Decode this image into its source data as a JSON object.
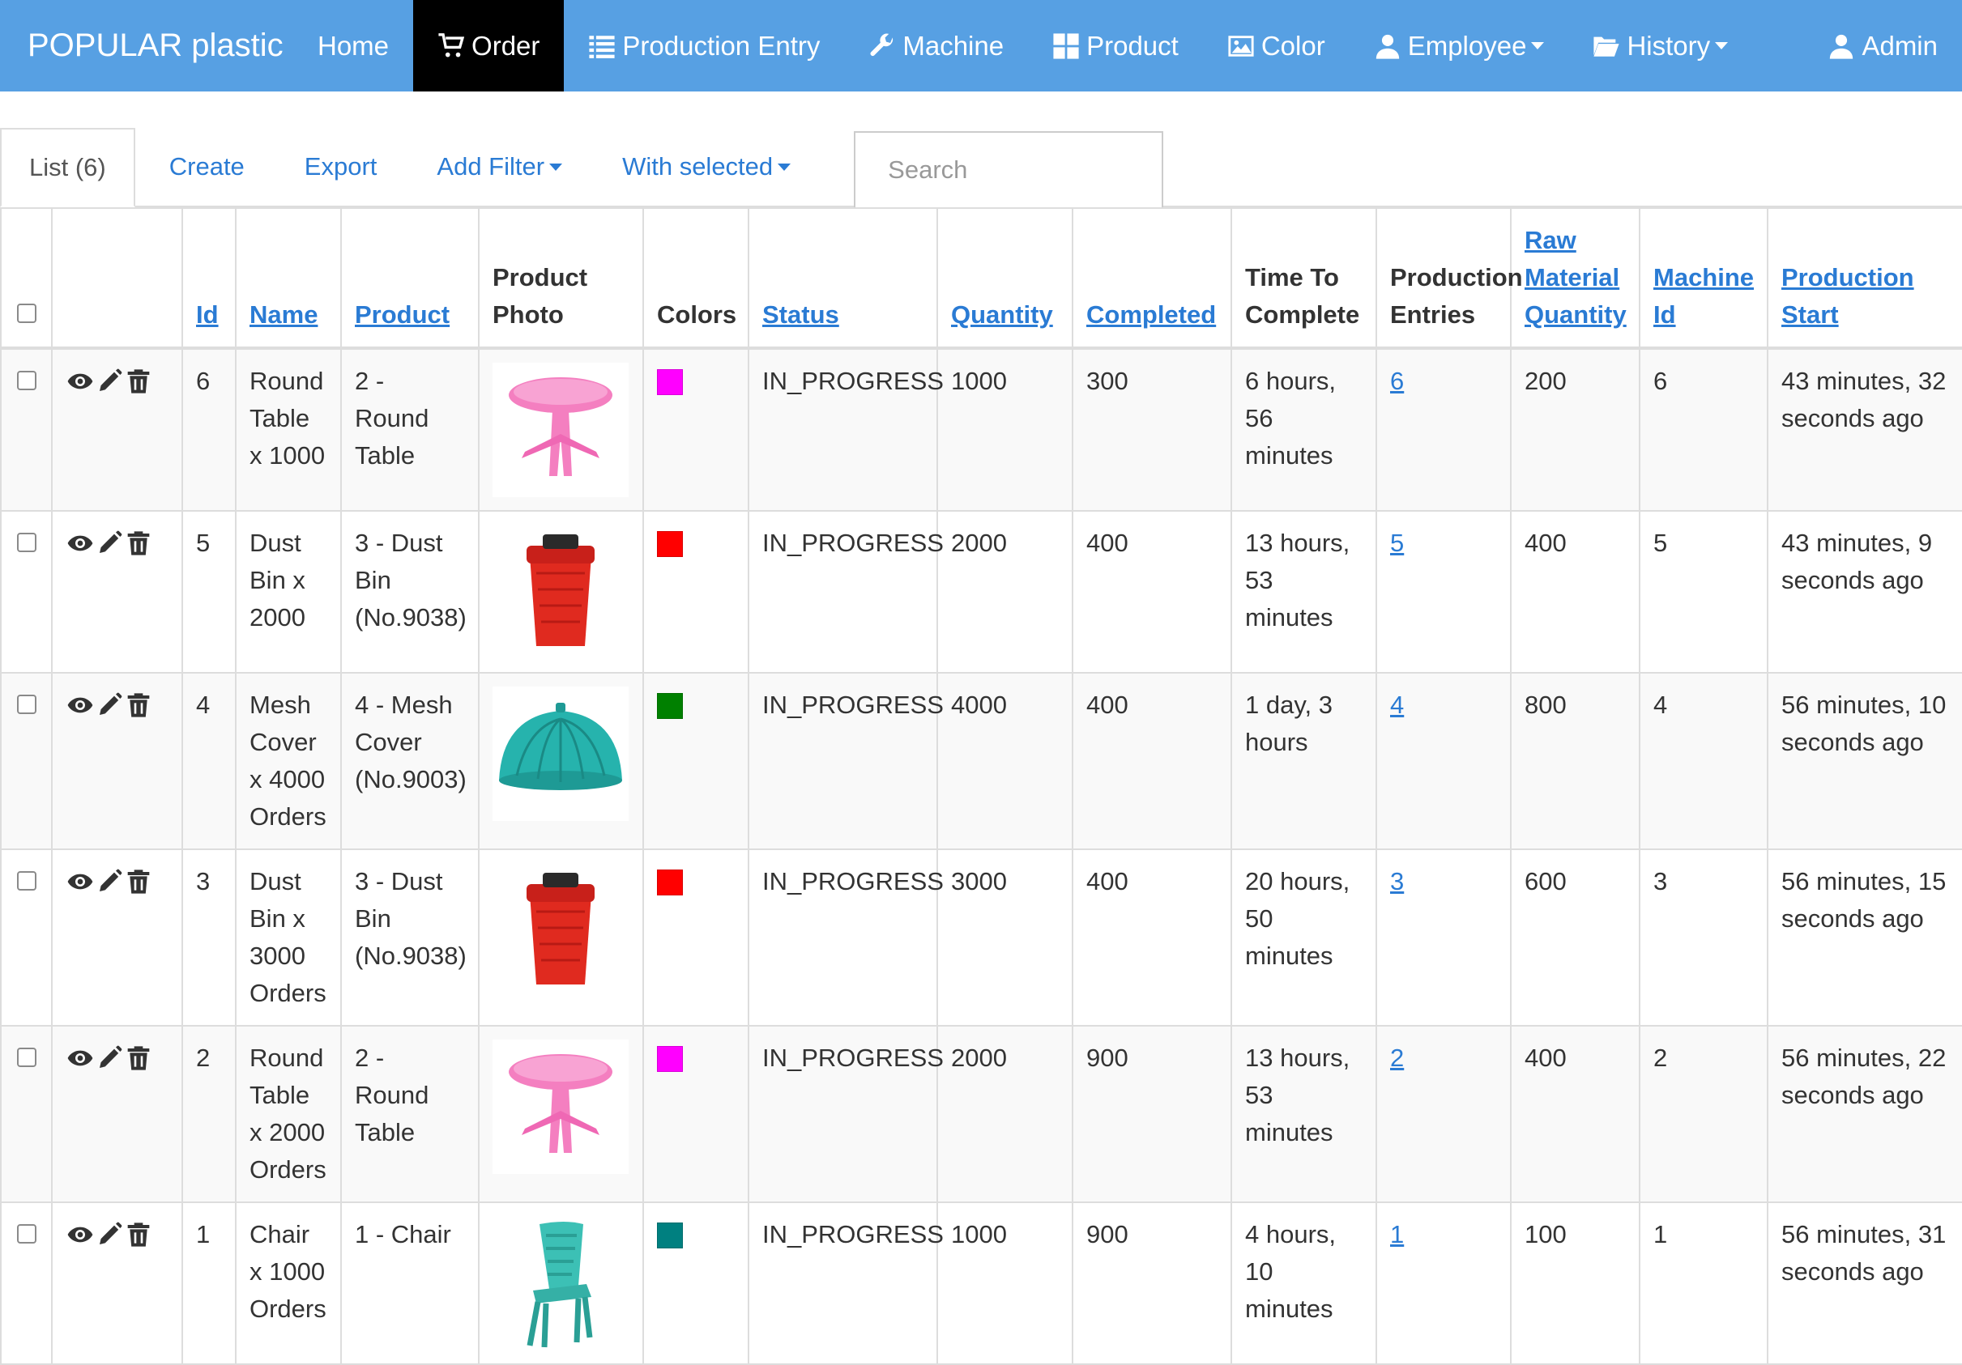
{
  "navbar": {
    "brand": "POPULAR plastic",
    "items": [
      {
        "label": "Home",
        "icon": "none",
        "active": false
      },
      {
        "label": "Order",
        "icon": "cart-icon",
        "active": true
      },
      {
        "label": "Production Entry",
        "icon": "list-icon",
        "active": false
      },
      {
        "label": "Machine",
        "icon": "wrench-icon",
        "active": false
      },
      {
        "label": "Product",
        "icon": "grid-icon",
        "active": false
      },
      {
        "label": "Color",
        "icon": "picture-icon",
        "active": false
      },
      {
        "label": "Employee",
        "icon": "user-icon",
        "active": false,
        "dropdown": true
      },
      {
        "label": "History",
        "icon": "folder-open-icon",
        "active": false,
        "dropdown": true
      }
    ],
    "user": {
      "label": "Admin",
      "icon": "user-icon"
    },
    "accent_color": "#57a0e3"
  },
  "tabs": {
    "list": "List (6)",
    "create": "Create",
    "export": "Export",
    "add_filter": "Add Filter",
    "with_selected": "With selected",
    "search_placeholder": "Search"
  },
  "table": {
    "headers": {
      "id": "Id",
      "name": "Name",
      "product": "Product",
      "product_photo": "Product Photo",
      "colors": "Colors",
      "status": "Status",
      "quantity": "Quantity",
      "completed": "Completed",
      "time_to_complete": "Time To Complete",
      "production_entries": "Production Entries",
      "raw_material_quantity": "Raw Material Quantity",
      "machine_id": "Machine Id",
      "production_start": "Production Start"
    },
    "rows": [
      {
        "id": "6",
        "name": "Round Table x 1000",
        "product": "2 - Round Table",
        "photo": "round-table-pink",
        "color": "#ff00ff",
        "status": "IN_PROGRESS",
        "quantity": "1000",
        "completed": "300",
        "time_to_complete": "6 hours, 56 minutes",
        "production_entries": "6",
        "raw_material_quantity": "200",
        "machine_id": "6",
        "production_start": "43 minutes, 32 seconds ago"
      },
      {
        "id": "5",
        "name": "Dust Bin x 2000",
        "product": "3 - Dust Bin (No.9038)",
        "photo": "dust-bin-red",
        "color": "#ff0000",
        "status": "IN_PROGRESS",
        "quantity": "2000",
        "completed": "400",
        "time_to_complete": "13 hours, 53 minutes",
        "production_entries": "5",
        "raw_material_quantity": "400",
        "machine_id": "5",
        "production_start": "43 minutes, 9 seconds ago"
      },
      {
        "id": "4",
        "name": "Mesh Cover x 4000 Orders",
        "product": "4 - Mesh Cover (No.9003)",
        "photo": "mesh-cover-teal",
        "color": "#008000",
        "status": "IN_PROGRESS",
        "quantity": "4000",
        "completed": "400",
        "time_to_complete": "1 day, 3 hours",
        "production_entries": "4",
        "raw_material_quantity": "800",
        "machine_id": "4",
        "production_start": "56 minutes, 10 seconds ago"
      },
      {
        "id": "3",
        "name": "Dust Bin x 3000 Orders",
        "product": "3 - Dust Bin (No.9038)",
        "photo": "dust-bin-red",
        "color": "#ff0000",
        "status": "IN_PROGRESS",
        "quantity": "3000",
        "completed": "400",
        "time_to_complete": "20 hours, 50 minutes",
        "production_entries": "3",
        "raw_material_quantity": "600",
        "machine_id": "3",
        "production_start": "56 minutes, 15 seconds ago"
      },
      {
        "id": "2",
        "name": "Round Table x 2000 Orders",
        "product": "2 - Round Table",
        "photo": "round-table-pink",
        "color": "#ff00ff",
        "status": "IN_PROGRESS",
        "quantity": "2000",
        "completed": "900",
        "time_to_complete": "13 hours, 53 minutes",
        "production_entries": "2",
        "raw_material_quantity": "400",
        "machine_id": "2",
        "production_start": "56 minutes, 22 seconds ago"
      },
      {
        "id": "1",
        "name": "Chair x 1000 Orders",
        "product": "1 - Chair",
        "photo": "chair-teal",
        "color": "#008080",
        "status": "IN_PROGRESS",
        "quantity": "1000",
        "completed": "900",
        "time_to_complete": "4 hours, 10 minutes",
        "production_entries": "1",
        "raw_material_quantity": "100",
        "machine_id": "1",
        "production_start": "56 minutes, 31 seconds ago"
      }
    ]
  }
}
